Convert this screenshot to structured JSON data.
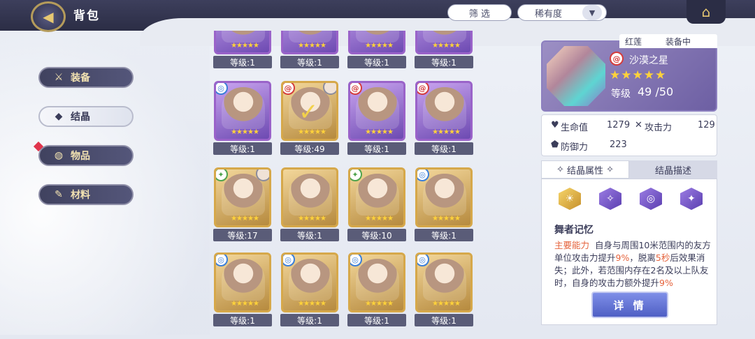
{
  "header": {
    "title": "背包",
    "back_icon": "back-arrow-icon",
    "filter_label": "筛 选",
    "sort_label": "稀有度",
    "sort_arrow": "chevron-down-icon",
    "home_icon": "home-icon"
  },
  "sidebar": {
    "items": [
      {
        "label": "装备",
        "icon": "sword-icon"
      },
      {
        "label": "结晶",
        "icon": "crystal-icon",
        "active": true
      },
      {
        "label": "物品",
        "icon": "bag-icon",
        "has_alert": true
      },
      {
        "label": "材料",
        "icon": "tool-icon"
      }
    ]
  },
  "grid": {
    "cards": [
      {
        "level": "等级:1",
        "rarity": "purple",
        "badge": "",
        "stars": "★★★★★"
      },
      {
        "level": "等级:1",
        "rarity": "purple",
        "badge": "",
        "stars": "★★★★★"
      },
      {
        "level": "等级:1",
        "rarity": "purple",
        "badge": "",
        "stars": "★★★★★"
      },
      {
        "level": "等级:1",
        "rarity": "purple",
        "badge": "",
        "stars": "★★★★★"
      },
      {
        "level": "等级:1",
        "rarity": "purple",
        "badge": "◎",
        "badge_color": "blue",
        "stars": "★★★★★"
      },
      {
        "level": "等级:49",
        "rarity": "gold",
        "badge": "@",
        "badge_color": "red",
        "stars": "★★★★★",
        "equipped": true,
        "checked": true
      },
      {
        "level": "等级:1",
        "rarity": "purple",
        "badge": "@",
        "badge_color": "red",
        "stars": "★★★★★"
      },
      {
        "level": "等级:1",
        "rarity": "purple",
        "badge": "@",
        "badge_color": "red",
        "stars": "★★★★★"
      },
      {
        "level": "等级:17",
        "rarity": "gold",
        "badge": "✦",
        "badge_color": "green",
        "stars": "★★★★★",
        "equipped": true
      },
      {
        "level": "等级:1",
        "rarity": "gold",
        "badge": "",
        "stars": "★★★★★"
      },
      {
        "level": "等级:10",
        "rarity": "gold",
        "badge": "✦",
        "badge_color": "green",
        "stars": "★★★★★"
      },
      {
        "level": "等级:1",
        "rarity": "gold",
        "badge": "◎",
        "badge_color": "blue",
        "stars": "★★★★★"
      },
      {
        "level": "等级:1",
        "rarity": "gold",
        "badge": "◎",
        "badge_color": "blue",
        "stars": "★★★★★"
      },
      {
        "level": "等级:1",
        "rarity": "gold",
        "badge": "◎",
        "badge_color": "blue",
        "stars": "★★★★★"
      },
      {
        "level": "等级:1",
        "rarity": "gold",
        "badge": "◎",
        "badge_color": "blue",
        "stars": "★★★★★"
      },
      {
        "level": "等级:1",
        "rarity": "gold",
        "badge": "◎",
        "badge_color": "blue",
        "stars": "★★★★★"
      }
    ]
  },
  "detail": {
    "owner": "红莲",
    "equip_status": "装备中",
    "name": "沙漠之星",
    "stars": "★★★★★",
    "level_label": "等级",
    "level_value": "49 /50",
    "stats": [
      {
        "icon": "heart-icon",
        "label": "生命值",
        "value": "1279"
      },
      {
        "icon": "crossed-swords-icon",
        "label": "攻击力",
        "value": "129"
      },
      {
        "icon": "shield-icon",
        "label": "防御力",
        "value": "223"
      }
    ],
    "tabs": {
      "attr": "结晶属性",
      "desc": "结晶描述"
    },
    "skill_icons": [
      "sun-icon",
      "rune-icon",
      "swirl-icon",
      "rune-icon"
    ],
    "skill_title": "舞者记忆",
    "skill_desc": {
      "tag": "主要能力",
      "p1": "自身与周围10米范围内的友方单位攻击力提升",
      "hl1": "9%",
      "p2": "，脱离",
      "hl2": "5秒",
      "p3": "后效果消失；此外，若范围内存在2名及以上队友时，自身的攻击力额外提升",
      "hl3": "9%"
    },
    "button": "详 情"
  }
}
